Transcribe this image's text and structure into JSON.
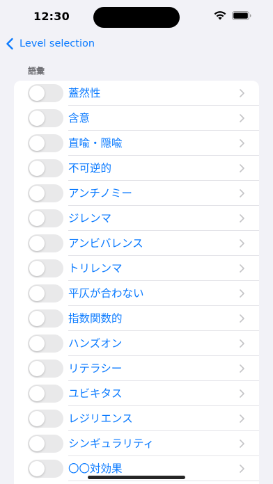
{
  "status": {
    "time": "12:30"
  },
  "nav": {
    "back_label": "Level selection"
  },
  "section": {
    "header": "語彙"
  },
  "items": [
    {
      "label": "蓋然性",
      "on": false
    },
    {
      "label": "含意",
      "on": false
    },
    {
      "label": "直喩・隠喩",
      "on": false
    },
    {
      "label": "不可逆的",
      "on": false
    },
    {
      "label": "アンチノミー",
      "on": false
    },
    {
      "label": "ジレンマ",
      "on": false
    },
    {
      "label": "アンビバレンス",
      "on": false
    },
    {
      "label": "トリレンマ",
      "on": false
    },
    {
      "label": "平仄が合わない",
      "on": false
    },
    {
      "label": "指数関数的",
      "on": false
    },
    {
      "label": "ハンズオン",
      "on": false
    },
    {
      "label": "リテラシー",
      "on": false
    },
    {
      "label": "ユビキタス",
      "on": false
    },
    {
      "label": "レジリエンス",
      "on": false
    },
    {
      "label": "シンギュラリティ",
      "on": false
    },
    {
      "label": "〇〇対効果",
      "on": false
    }
  ],
  "colors": {
    "accent": "#0a7aff",
    "toggle_off": "#e9e9ea",
    "background": "#f2f2f7"
  }
}
